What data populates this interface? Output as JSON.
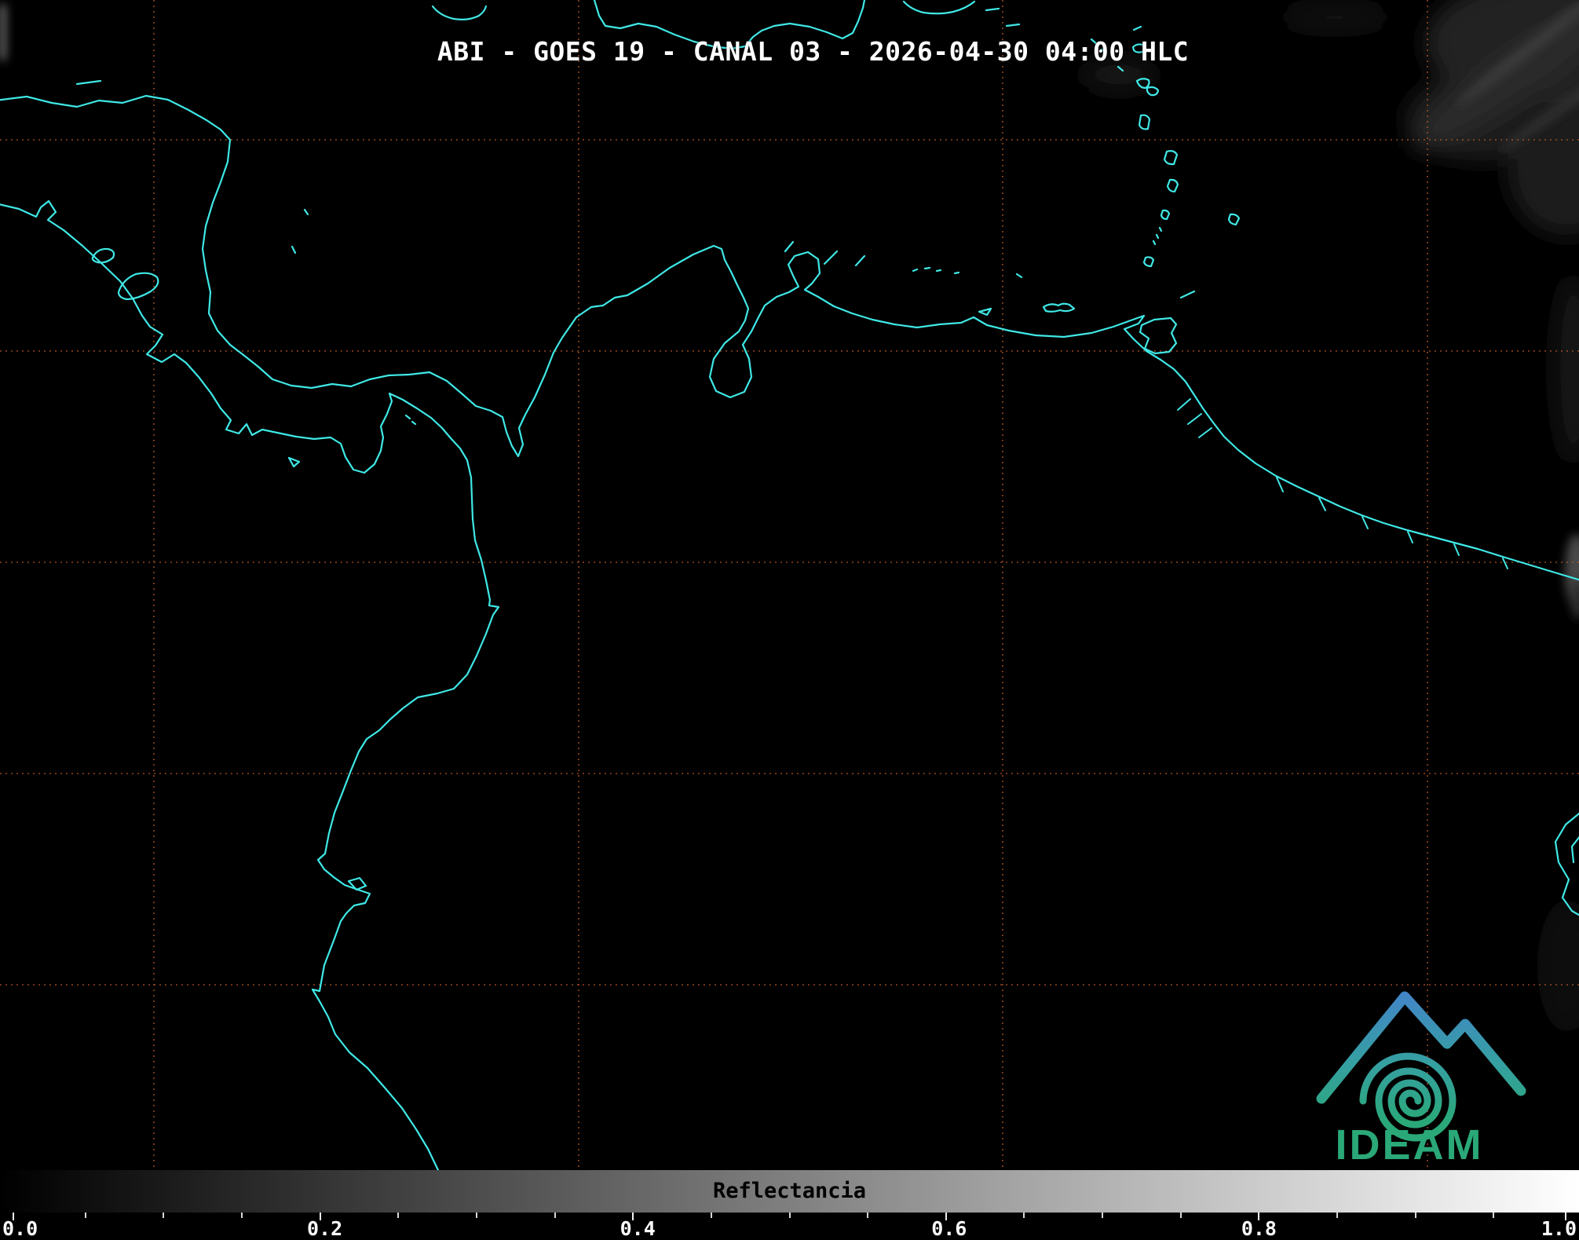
{
  "title": "ABI - GOES 19 - CANAL 03 - 2026-04-30 04:00 HLC",
  "satellite_image": {
    "description": "Nighttime GOES-19 ABI channel 03 reflectance scene over Central America, the Caribbean and northern South America",
    "overlays": [
      "cyan-coastlines",
      "orange-dashed-latlon-grid",
      "faint-clouds-upper-right"
    ]
  },
  "colorbar": {
    "label": "Reflectancia",
    "ticks": [
      "0.0",
      "0.2",
      "0.4",
      "0.6",
      "0.8",
      "1.0"
    ],
    "gradient_start": "#000000",
    "gradient_end": "#ffffff"
  },
  "logo": {
    "text": "IDEAM"
  },
  "colors": {
    "background": "#000000",
    "coastline": "#3fe8e6",
    "grid": "#bb5a2a",
    "title_text": "#ffffff",
    "logo_blue": "#4285c8",
    "logo_green": "#2aa878"
  }
}
